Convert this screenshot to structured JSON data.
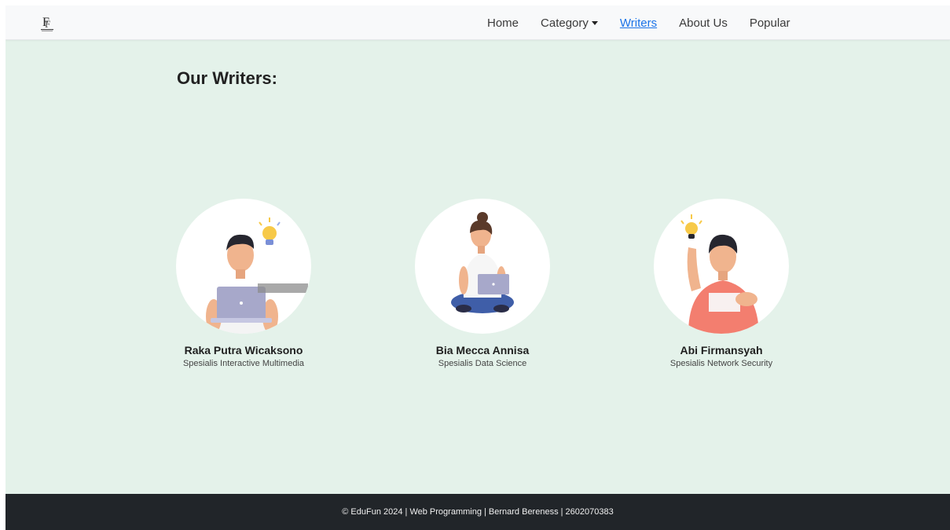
{
  "brand": {
    "logo_icon": "edufun-logo-icon"
  },
  "nav": {
    "items": [
      {
        "label": "Home",
        "active": false
      },
      {
        "label": "Category",
        "active": false,
        "dropdown": true
      },
      {
        "label": "Writers",
        "active": true
      },
      {
        "label": "About Us",
        "active": false
      },
      {
        "label": "Popular",
        "active": false
      }
    ]
  },
  "page": {
    "title": "Our Writers:"
  },
  "writers": [
    {
      "name": "Raka Putra Wicaksono",
      "role": "Spesialis Interactive Multimedia",
      "avatar_icon": "writer-avatar-laptop-man-icon"
    },
    {
      "name": "Bia Mecca Annisa",
      "role": "Spesialis Data Science",
      "avatar_icon": "writer-avatar-sitting-woman-icon"
    },
    {
      "name": "Abi Firmansyah",
      "role": "Spesialis Network Security",
      "avatar_icon": "writer-avatar-idea-man-icon"
    }
  ],
  "footer": {
    "text": "© EduFun 2024 | Web Programming | Bernard Bereness | 2602070383"
  },
  "colors": {
    "background": "#e4f2ea",
    "navbar": "#f8f9fa",
    "active_link": "#1a73e8",
    "footer": "#212529"
  }
}
